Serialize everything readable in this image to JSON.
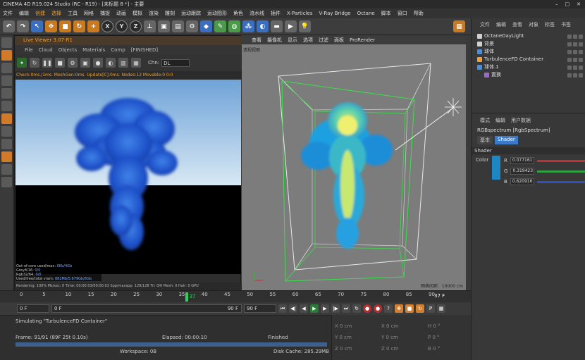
{
  "window": {
    "title": "CINEMA 4D R19.024 Studio (RC - R19) - [未标题 8 *] - 主要"
  },
  "menubar": [
    "文件",
    "编辑",
    "创建",
    "选择",
    "工具",
    "网格",
    "捕捉",
    "动画",
    "模拟",
    "渲染",
    "雕刻",
    "运动跟踪",
    "运动图形",
    "角色",
    "流水线",
    "插件",
    "X-Particles",
    "V-Ray Bridge",
    "Octane",
    "脚本",
    "窗口",
    "帮助"
  ],
  "toolbar": {
    "axis_x": "X",
    "axis_y": "Y",
    "axis_z": "Z"
  },
  "liveviewer": {
    "title": "Live Viewer 3.07-R1",
    "menu": [
      "File",
      "Cloud",
      "Objects",
      "Materials",
      "Comp",
      "[FINISHED]"
    ],
    "chn_label": "Chn:",
    "chn_value": "DL",
    "status": "Check:0ms./1ms. MeshGen:0ms. Update[C]:0ms. Nodes:12 Movable:0 0:0",
    "stats": [
      {
        "label": "Out-of-core used/max:",
        "value": "0Kb/4Gb"
      },
      {
        "label": "Grey8/16:",
        "value": "0/0"
      },
      {
        "label": "Rgb32/64:",
        "value": "0/0"
      },
      {
        "label": "Used/free/total vram:",
        "value": "882Mb/5.879Gb/8Gb"
      }
    ],
    "footer": "Rendering: 100%  Ms/sec: 0  Time: 00:00:03/00:00:03  Spp/maxspp: 128/128  Tri: 0/0  Mesh: 0  Hair: 0  GPU"
  },
  "viewport": {
    "menu": [
      "查看",
      "摄像机",
      "显示",
      "选项",
      "过滤",
      "面板",
      "ProRender"
    ],
    "label": "透视视图",
    "scale": "网格间距：10000 cm"
  },
  "timeline": {
    "ticks": [
      "0",
      "5",
      "10",
      "15",
      "20",
      "25",
      "30",
      "35",
      "40",
      "45",
      "50",
      "55",
      "60",
      "65",
      "70",
      "75",
      "80",
      "85",
      "90"
    ],
    "current_frame": "37",
    "current_display": "37 F"
  },
  "transport": {
    "start": "0 F",
    "range_start": "0 F",
    "range_end": "90 F",
    "end": "90 F"
  },
  "simulation": {
    "title": "Simulating \"TurbulenceFD Container\"",
    "frame": "Frame: 91/91 (89F 25t 0.10s)",
    "elapsed": "Elapsed: 00:00:10",
    "status": "Finished",
    "workspace": "Workspace: 0B",
    "disk_cache": "Disk Cache: 285.29MB",
    "progress": 1.0
  },
  "coords": {
    "rows": [
      [
        {
          "axis": "X",
          "value": "0 cm"
        },
        {
          "axis": "X",
          "value": "0 cm"
        },
        {
          "axis": "H",
          "value": "0 °"
        }
      ],
      [
        {
          "axis": "Y",
          "value": "0 cm"
        },
        {
          "axis": "Y",
          "value": "0 cm"
        },
        {
          "axis": "P",
          "value": "0 °"
        }
      ],
      [
        {
          "axis": "Z",
          "value": "0 cm"
        },
        {
          "axis": "Z",
          "value": "0 cm"
        },
        {
          "axis": "B",
          "value": "0 °"
        }
      ]
    ]
  },
  "object_manager": {
    "menu": [
      "文件",
      "编辑",
      "查看",
      "对象",
      "标签",
      "书签"
    ],
    "objects": [
      {
        "name": "OctaneDayLight",
        "indent": 0,
        "color": "#d0d0d0"
      },
      {
        "name": "背景",
        "indent": 0,
        "color": "#d0d0d0"
      },
      {
        "name": "球体",
        "indent": 0,
        "color": "#4a90d9"
      },
      {
        "name": "TurbulenceFD Container",
        "indent": 0,
        "color": "#f0a030"
      },
      {
        "name": "球体.1",
        "indent": 0,
        "color": "#4a90d9"
      },
      {
        "name": "置换",
        "indent": 1,
        "color": "#9a6ad0"
      }
    ]
  },
  "attributes": {
    "menu": [
      "模式",
      "编辑",
      "用户数据"
    ],
    "title": "RGBspectrum [RgbSpectrum]",
    "tabs": [
      "基本",
      "Shader"
    ],
    "section": "Shader",
    "color_label": "Color",
    "channels": [
      {
        "label": "R",
        "value": "0.077161",
        "color": "#c03030"
      },
      {
        "label": "G",
        "value": "0.319423",
        "color": "#30a040"
      },
      {
        "label": "B",
        "value": "0.620916",
        "color": "#3050c0"
      }
    ],
    "swatch": "#1f86c4"
  }
}
